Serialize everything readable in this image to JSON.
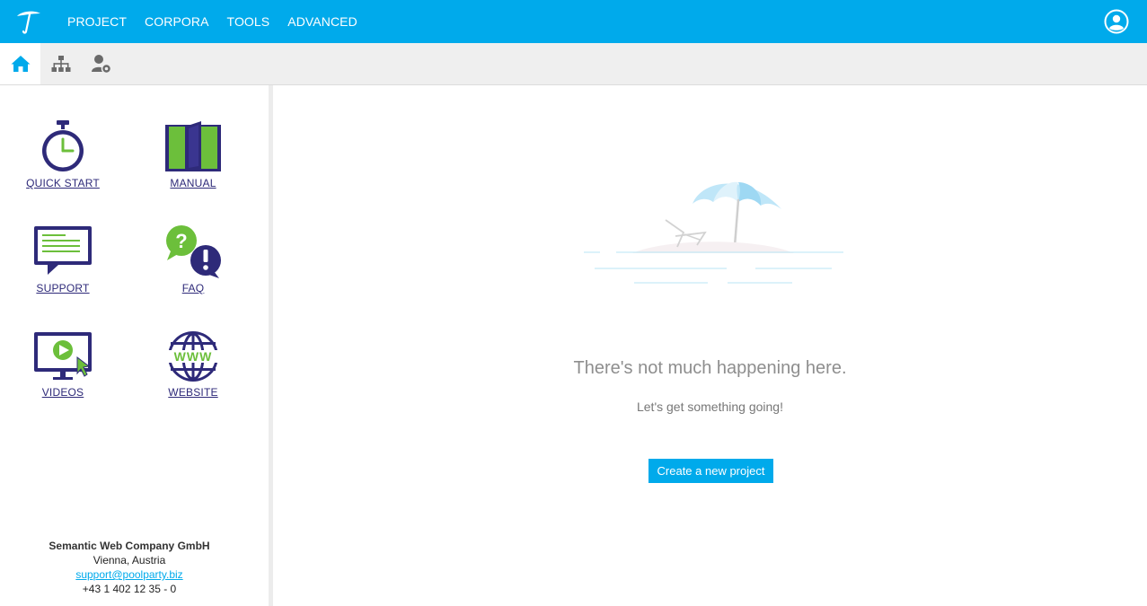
{
  "topbar": {
    "logo_icon": "umbrella-logo-icon",
    "nav": [
      {
        "label": "PROJECT"
      },
      {
        "label": "CORPORA"
      },
      {
        "label": "TOOLS"
      },
      {
        "label": "ADVANCED"
      }
    ],
    "user_icon": "user-circle-icon",
    "color": "#00aaeb"
  },
  "toolbar": {
    "buttons": [
      {
        "icon": "home-icon",
        "active": true
      },
      {
        "icon": "hierarchy-icon",
        "active": false
      },
      {
        "icon": "user-settings-icon",
        "active": false
      }
    ]
  },
  "sidebar": {
    "items": [
      {
        "label": "QUICK START",
        "icon": "stopwatch-icon"
      },
      {
        "label": "MANUAL",
        "icon": "book-icon"
      },
      {
        "label": "SUPPORT",
        "icon": "support-chat-icon"
      },
      {
        "label": "FAQ",
        "icon": "faq-bubbles-icon"
      },
      {
        "label": "VIDEOS",
        "icon": "video-monitor-icon"
      },
      {
        "label": "WEBSITE",
        "icon": "globe-www-icon"
      }
    ],
    "company": {
      "name": "Semantic Web Company GmbH",
      "location": "Vienna, Austria",
      "email": "support@poolparty.biz",
      "phone": "+43 1 402 12 35 - 0"
    }
  },
  "main": {
    "illustration": "beach-umbrella-illustration",
    "title": "There's not much happening here.",
    "subtitle": "Let's get something going!",
    "create_button": "Create a new project"
  }
}
